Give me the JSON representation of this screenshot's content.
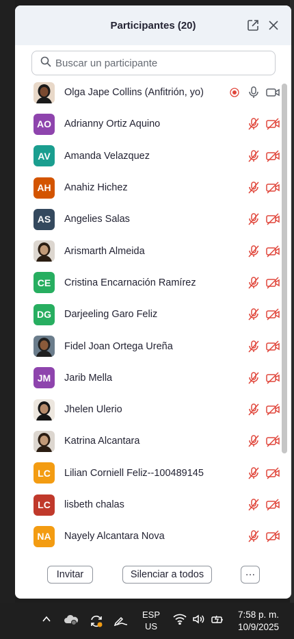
{
  "panel": {
    "title": "Participantes (20)",
    "search_placeholder": "Buscar un participante"
  },
  "colors": {
    "muted_red": "#e0463b",
    "record_red": "#e0463b",
    "panel_header_bg": "#eef2f7"
  },
  "participants": [
    {
      "name": "Olga Jape Collins (Anfitrión, yo)",
      "initials": "",
      "avatar": "photo",
      "status": "host-active"
    },
    {
      "name": "Adrianny Ortiz Aquino",
      "initials": "AO",
      "color": "#8e44ad",
      "status": "muted-video-off"
    },
    {
      "name": "Amanda Velazquez",
      "initials": "AV",
      "color": "#1a9e8f",
      "status": "muted-video-off"
    },
    {
      "name": "Anahiz Hichez",
      "initials": "AH",
      "color": "#d35400",
      "status": "muted-video-off"
    },
    {
      "name": "Angelies Salas",
      "initials": "AS",
      "color": "#34495e",
      "status": "muted-video-off"
    },
    {
      "name": "Arismarth Almeida",
      "initials": "",
      "avatar": "photo",
      "status": "muted-video-off"
    },
    {
      "name": "Cristina Encarnación Ramírez",
      "initials": "CE",
      "color": "#27ae60",
      "status": "muted-video-off"
    },
    {
      "name": "Darjeeling Garo Feliz",
      "initials": "DG",
      "color": "#27ae60",
      "status": "muted-video-off"
    },
    {
      "name": "Fidel Joan Ortega Ureña",
      "initials": "",
      "avatar": "photo",
      "status": "muted-video-off"
    },
    {
      "name": "Jarib Mella",
      "initials": "JM",
      "color": "#8e44ad",
      "status": "muted-video-off"
    },
    {
      "name": "Jhelen Ulerio",
      "initials": "",
      "avatar": "photo",
      "status": "muted-video-off"
    },
    {
      "name": "Katrina Alcantara",
      "initials": "",
      "avatar": "photo",
      "status": "muted-video-off"
    },
    {
      "name": "Lilian Corniell Feliz--100489145",
      "initials": "LC",
      "color": "#f39c12",
      "status": "muted-video-off"
    },
    {
      "name": "lisbeth chalas",
      "initials": "LC",
      "color": "#c0392b",
      "status": "muted-video-off"
    },
    {
      "name": "Nayely Alcantara Nova",
      "initials": "NA",
      "color": "#f39c12",
      "status": "muted-video-off"
    }
  ],
  "footer": {
    "invite_label": "Invitar",
    "mute_all_label": "Silenciar a todos",
    "more_label": "···"
  },
  "taskbar": {
    "lang_line1": "ESP",
    "lang_line2": "US",
    "time": "7:58 p. m.",
    "date": "10/9/2025",
    "icons": [
      "chevron-up-icon",
      "onedrive-icon",
      "sync-icon",
      "pen-icon",
      "wifi-icon",
      "volume-icon",
      "battery-icon"
    ]
  }
}
